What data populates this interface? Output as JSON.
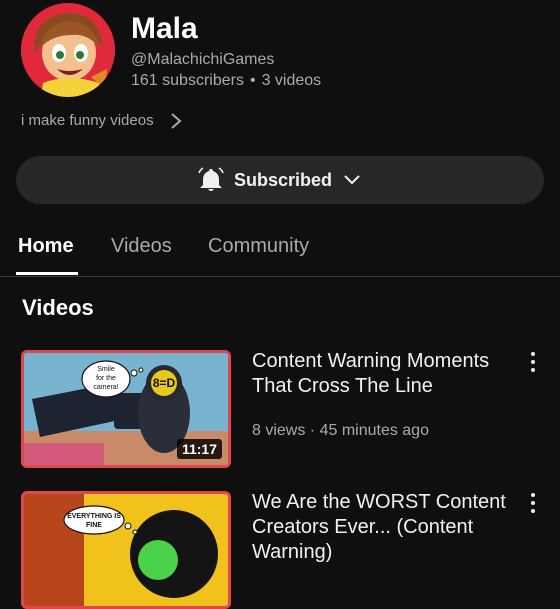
{
  "channel": {
    "name": "Mala",
    "handle": "@MalachichiGames",
    "subscribers": "161 subscribers",
    "separator": "•",
    "video_count": "3 videos",
    "description": "i make funny videos"
  },
  "subscribe_button": {
    "label": "Subscribed",
    "icon": "bell-icon"
  },
  "tabs": [
    {
      "label": "Home",
      "active": true
    },
    {
      "label": "Videos",
      "active": false
    },
    {
      "label": "Community",
      "active": false
    }
  ],
  "section": {
    "title": "Videos"
  },
  "videos": [
    {
      "title": "Content Warning Moments That Cross The Line",
      "meta": "8 views · 45 minutes ago",
      "duration": "11:17",
      "thumb_bubble_left": "Smile for the camera!",
      "thumb_bubble_right": "8=D"
    },
    {
      "title": "We Are the WORST Content Creators Ever... (Content Warning)",
      "meta": "",
      "duration": "",
      "thumb_bubble_left": "EVERYTHING IS FINE"
    }
  ],
  "colors": {
    "background": "#0f0f0f",
    "button": "#272727",
    "accent_border": "#e0474c",
    "avatar_bg": "#e02a3c"
  }
}
